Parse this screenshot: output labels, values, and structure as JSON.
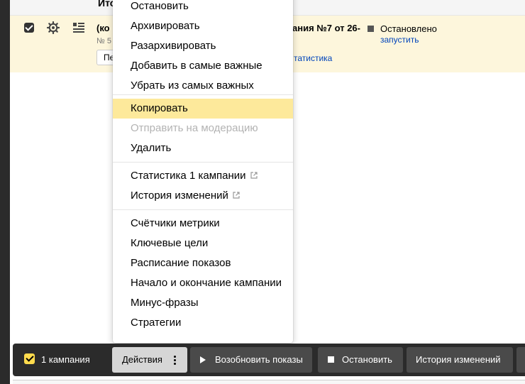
{
  "header": {
    "column_label": "Ито"
  },
  "campaign": {
    "name_fragment": "(ко",
    "number_fragment": "№ 5",
    "button_fragment": "Пе",
    "title_fragment": "ания №7 от 26-",
    "status": "Остановлено",
    "start_link": "запустить",
    "stats_link_fragment": "татистика"
  },
  "menu": {
    "items": [
      {
        "label": "Остановить"
      },
      {
        "label": "Архивировать"
      },
      {
        "label": "Разархивировать"
      },
      {
        "label": "Добавить в самые важные"
      },
      {
        "label": "Убрать из самых важных"
      },
      {
        "label": "Копировать"
      },
      {
        "label": "Отправить на модерацию"
      },
      {
        "label": "Удалить"
      },
      {
        "label": "Статистика 1 кампании"
      },
      {
        "label": "История изменений"
      },
      {
        "label": "Счётчики метрики"
      },
      {
        "label": "Ключевые цели"
      },
      {
        "label": "Расписание показов"
      },
      {
        "label": "Начало и окончание кампании"
      },
      {
        "label": "Минус-фразы"
      },
      {
        "label": "Стратегии"
      }
    ]
  },
  "bottom_bar": {
    "selected_count": "1 кампания",
    "actions": "Действия",
    "resume": "Возобновить показы",
    "stop": "Остановить",
    "history": "История изменений"
  },
  "colors": {
    "highlight": "#fde99b",
    "row_selected": "#fdf6dc",
    "link": "#0044bb",
    "bar": "#2b2b2b",
    "accent": "#ffdb4d"
  },
  "icons": [
    "gear-icon",
    "list-icon",
    "external-link-icon",
    "play-icon",
    "stop-icon",
    "more-dots-icon",
    "checkbox-icon"
  ]
}
